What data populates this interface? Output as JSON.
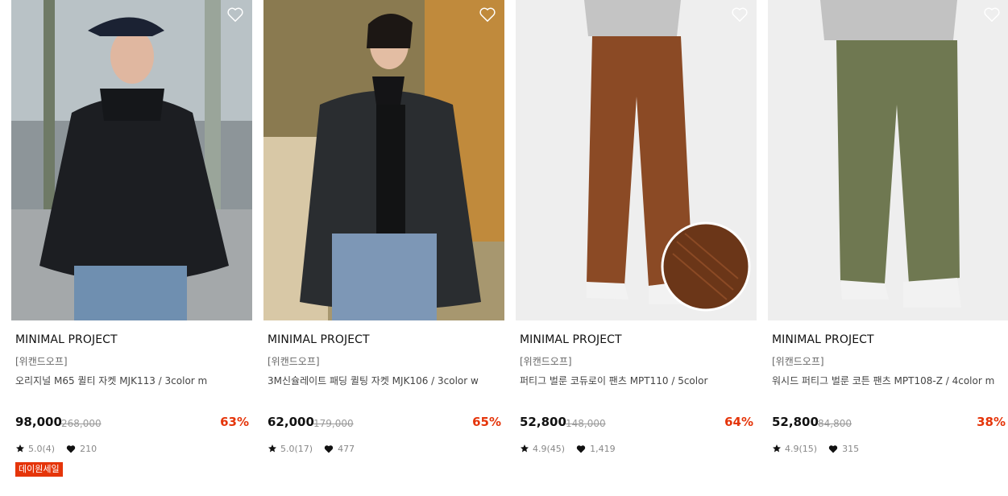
{
  "colors": {
    "discount": "#e5350a",
    "badge_bg": "#e5350a",
    "strike": "#999999"
  },
  "icons": {
    "wishlist": "heart-outline-icon",
    "rating": "star-icon",
    "likes": "heart-icon"
  },
  "products": [
    {
      "brand": "MINIMAL PROJECT",
      "tag": "[위캔드오프]",
      "name": "오리지널 M65 퀼티 자켓 MJK113 / 3color m",
      "price": "98,000",
      "original_price": "268,000",
      "discount": "63%",
      "rating": "5.0(4)",
      "likes": "210",
      "badge": "데이원세일"
    },
    {
      "brand": "MINIMAL PROJECT",
      "tag": "[위캔드오프]",
      "name": "3M신슐레이트 패딩 퀼팅 자켓 MJK106 / 3color w",
      "price": "62,000",
      "original_price": "179,000",
      "discount": "65%",
      "rating": "5.0(17)",
      "likes": "477",
      "badge": ""
    },
    {
      "brand": "MINIMAL PROJECT",
      "tag": "[위캔드오프]",
      "name": "퍼티그 벌룬 코듀로이 팬츠 MPT110 / 5color",
      "price": "52,800",
      "original_price": "148,000",
      "discount": "64%",
      "rating": "4.9(45)",
      "likes": "1,419",
      "badge": ""
    },
    {
      "brand": "MINIMAL PROJECT",
      "tag": "[위캔드오프]",
      "name": "워시드 퍼티그 벌룬 코튼 팬츠 MPT108-Z / 4color m",
      "price": "52,800",
      "original_price": "84,800",
      "discount": "38%",
      "rating": "4.9(15)",
      "likes": "315",
      "badge": ""
    }
  ]
}
